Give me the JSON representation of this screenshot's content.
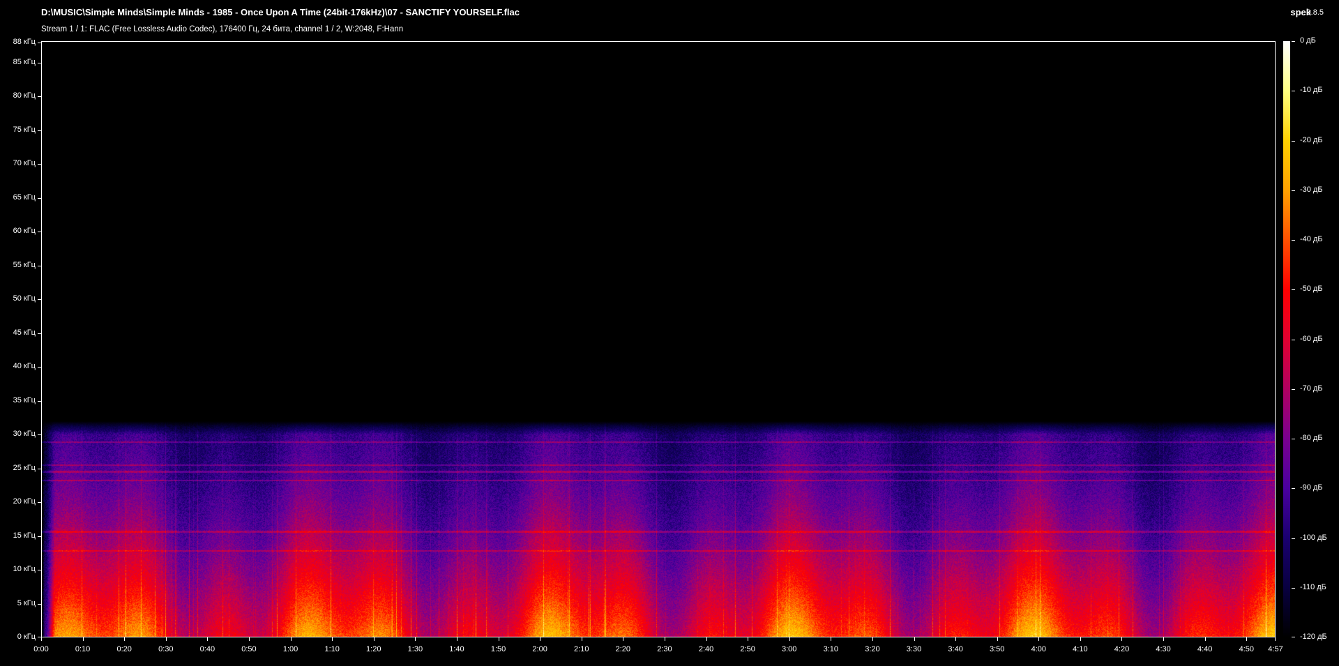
{
  "header": {
    "file_path": "D:\\MUSIC\\Simple Minds\\Simple Minds - 1985 - Once Upon A Time (24bit-176kHz)\\07 - SANCTIFY YOURSELF.flac",
    "stream_info": "Stream 1 / 1: FLAC (Free Lossless Audio Codec), 176400 Гц, 24 бита, channel 1 / 2, W:2048, F:Hann",
    "app_name": "spek",
    "app_version": "0.8.5"
  },
  "frequency_axis": {
    "unit": "кГц",
    "labels": [
      "88 кГц",
      "85 кГц",
      "80 кГц",
      "75 кГц",
      "70 кГц",
      "65 кГц",
      "60 кГц",
      "55 кГц",
      "50 кГц",
      "45 кГц",
      "40 кГц",
      "35 кГц",
      "30 кГц",
      "25 кГц",
      "20 кГц",
      "15 кГц",
      "10 кГц",
      "5 кГц",
      "0 кГц"
    ],
    "values_khz": [
      88,
      85,
      80,
      75,
      70,
      65,
      60,
      55,
      50,
      45,
      40,
      35,
      30,
      25,
      20,
      15,
      10,
      5,
      0
    ],
    "max_khz": 88.2
  },
  "time_axis": {
    "labels": [
      "0:00",
      "0:10",
      "0:20",
      "0:30",
      "0:40",
      "0:50",
      "1:00",
      "1:10",
      "1:20",
      "1:30",
      "1:40",
      "1:50",
      "2:00",
      "2:10",
      "2:20",
      "2:30",
      "2:40",
      "2:50",
      "3:00",
      "3:10",
      "3:20",
      "3:30",
      "3:40",
      "3:50",
      "4:00",
      "4:10",
      "4:20",
      "4:30",
      "4:40",
      "4:50",
      "4:57"
    ],
    "values_sec": [
      0,
      10,
      20,
      30,
      40,
      50,
      60,
      70,
      80,
      90,
      100,
      110,
      120,
      130,
      140,
      150,
      160,
      170,
      180,
      190,
      200,
      210,
      220,
      230,
      240,
      250,
      260,
      270,
      280,
      290,
      297
    ],
    "duration_sec": 297
  },
  "color_scale": {
    "labels": [
      "0 дБ",
      "-10 дБ",
      "-20 дБ",
      "-30 дБ",
      "-40 дБ",
      "-50 дБ",
      "-60 дБ",
      "-70 дБ",
      "-80 дБ",
      "-90 дБ",
      "-100 дБ",
      "-110 дБ",
      "-120 дБ"
    ],
    "values_db": [
      0,
      -10,
      -20,
      -30,
      -40,
      -50,
      -60,
      -70,
      -80,
      -90,
      -100,
      -110,
      -120
    ],
    "colors": [
      "#ffffff",
      "#ffff80",
      "#ffd000",
      "#ffa000",
      "#ff5000",
      "#ff0000",
      "#e00030",
      "#b00060",
      "#7a0090",
      "#4a00a0",
      "#1a0070",
      "#080040",
      "#000000"
    ]
  },
  "spectrogram": {
    "content_cutoff_khz": 30,
    "visible_tone_lines_khz": [
      28.9,
      25.5,
      24.5,
      23.2,
      15.6,
      12.8
    ]
  }
}
